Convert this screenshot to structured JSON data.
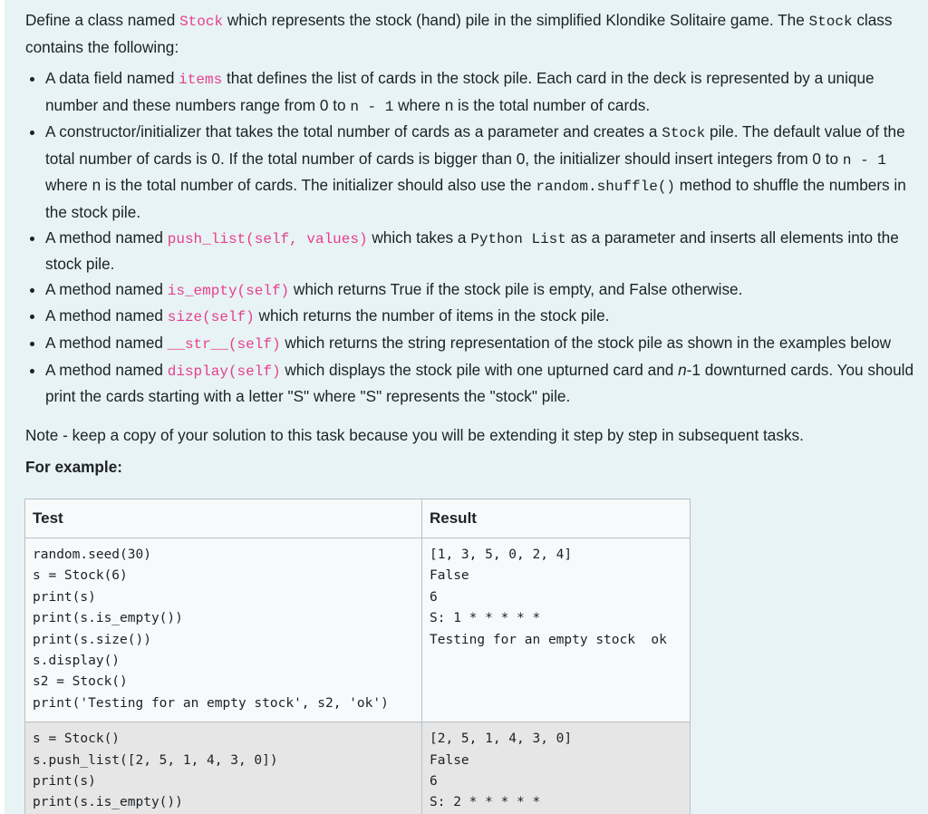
{
  "intro": {
    "t1": "Define a class named ",
    "c1": "Stock",
    "t2": " which represents the stock (hand) pile in the simplified Klondike Solitaire game. The ",
    "c2": "Stock",
    "t3": " class contains the following:"
  },
  "bullets": {
    "b1": {
      "t1": "A data field named ",
      "c1": "items",
      "t2": " that defines the list of cards in the stock pile. Each card in the deck is represented by a unique number and these numbers range from 0 to ",
      "c2": "n - 1",
      "t3": " where n is the total number of cards."
    },
    "b2": {
      "t1": "A constructor/initializer that takes the total number of cards as a parameter and creates a ",
      "c1": "Stock",
      "t2": " pile. The default value of the total number of cards is 0. If the total number of cards is bigger than 0, the initializer should insert integers from 0 to ",
      "c2": "n - 1",
      "t3": " where n is the total number of cards. The initializer should also use the ",
      "c3": "random.shuffle()",
      "t4": " method to shuffle the numbers in the stock pile."
    },
    "b3": {
      "t1": "A method named ",
      "c1": "push_list(self, values)",
      "t2": " which takes a ",
      "c2": "Python List",
      "t3": " as a parameter and inserts all elements into the stock pile."
    },
    "b4": {
      "t1": "A method named ",
      "c1": "is_empty(self)",
      "t2": " which returns True if the stock pile is empty, and False otherwise."
    },
    "b5": {
      "t1": "A method named ",
      "c1": "size(self)",
      "t2": " which returns the number of items in the stock pile."
    },
    "b6": {
      "t1": "A method named ",
      "c1": "__str__(self)",
      "t2": " which returns the string representation of the stock pile as shown in the examples below"
    },
    "b7": {
      "t1": "A method named ",
      "c1": "display(self)",
      "t2": " which displays the stock pile with one upturned card and ",
      "i1": "n",
      "t3": "-1 downturned cards. You should print the cards starting with a letter \"S\" where \"S\" represents the \"stock\" pile."
    }
  },
  "note": "Note - keep a copy of your solution to this task because you will be extending it step by step in subsequent tasks.",
  "for_example": "For example:",
  "table": {
    "headers": {
      "test": "Test",
      "result": "Result"
    },
    "rows": [
      {
        "test": [
          "random.seed(30)",
          "s = Stock(6)",
          "print(s)",
          "print(s.is_empty())",
          "print(s.size())",
          "s.display()",
          "s2 = Stock()",
          "print('Testing for an empty stock', s2, 'ok')"
        ],
        "result": [
          "[1, 3, 5, 0, 2, 4]",
          "False",
          "6",
          "S: 1 * * * * *",
          "Testing for an empty stock  ok"
        ]
      },
      {
        "test": [
          "s = Stock()",
          "s.push_list([2, 5, 1, 4, 3, 0])",
          "print(s)",
          "print(s.is_empty())"
        ],
        "result": [
          "[2, 5, 1, 4, 3, 0]",
          "False",
          "6",
          "S: 2 * * * * *"
        ]
      }
    ]
  }
}
